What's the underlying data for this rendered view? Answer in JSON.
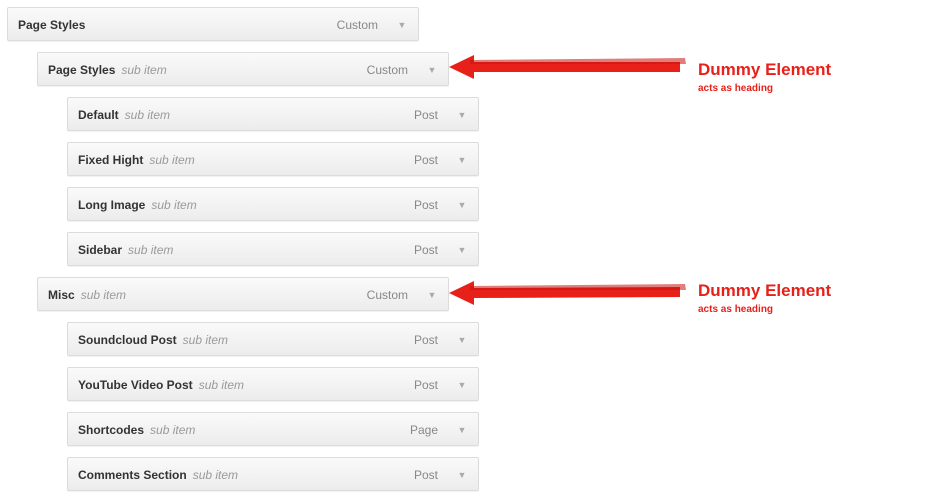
{
  "menu": {
    "items": [
      {
        "title": "Page Styles",
        "sub": "",
        "type": "Custom"
      },
      {
        "title": "Page Styles",
        "sub": "sub item",
        "type": "Custom"
      },
      {
        "title": "Default",
        "sub": "sub item",
        "type": "Post"
      },
      {
        "title": "Fixed Hight",
        "sub": "sub item",
        "type": "Post"
      },
      {
        "title": "Long Image",
        "sub": "sub item",
        "type": "Post"
      },
      {
        "title": "Sidebar",
        "sub": "sub item",
        "type": "Post"
      },
      {
        "title": "Misc",
        "sub": "sub item",
        "type": "Custom"
      },
      {
        "title": "Soundcloud Post",
        "sub": "sub item",
        "type": "Post"
      },
      {
        "title": "YouTube Video Post",
        "sub": "sub item",
        "type": "Post"
      },
      {
        "title": "Shortcodes",
        "sub": "sub item",
        "type": "Page"
      },
      {
        "title": "Comments Section",
        "sub": "sub item",
        "type": "Post"
      }
    ],
    "arrow_glyph": "▼"
  },
  "annotations": [
    {
      "heading": "Dummy Element",
      "note": "acts as heading"
    },
    {
      "heading": "Dummy Element",
      "note": "acts as heading"
    }
  ],
  "colors": {
    "annotation": "#e8201a"
  }
}
